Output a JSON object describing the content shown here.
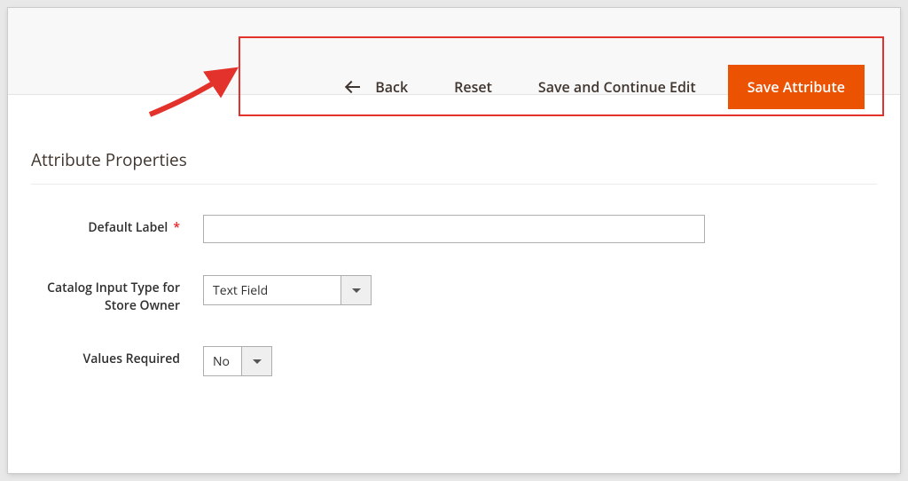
{
  "toolbar": {
    "back": "Back",
    "reset": "Reset",
    "save_continue": "Save and Continue Edit",
    "save": "Save Attribute"
  },
  "section_title": "Attribute Properties",
  "fields": {
    "default_label": {
      "label": "Default Label",
      "required": true,
      "value": ""
    },
    "catalog_input": {
      "label": "Catalog Input Type for Store Owner",
      "value": "Text Field"
    },
    "values_required": {
      "label": "Values Required",
      "value": "No"
    }
  }
}
